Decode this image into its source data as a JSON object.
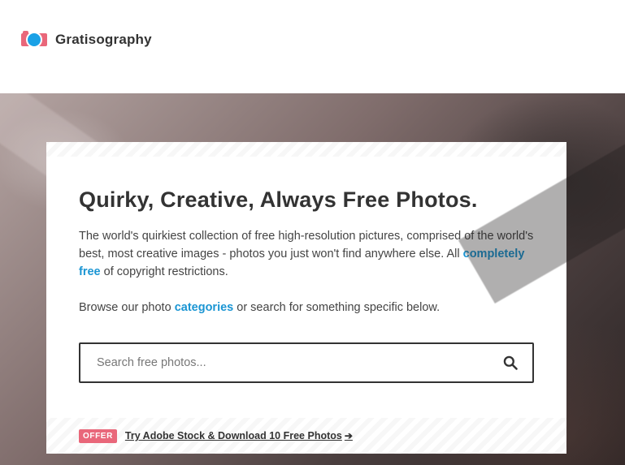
{
  "header": {
    "brand_name": "Gratisography"
  },
  "hero": {
    "title": "Quirky, Creative, Always Free Photos.",
    "intro": {
      "before_link": "The world's quirkiest collection of free high-resolution pictures, comprised of the world's best, most creative images - photos you just won't find anywhere else. All ",
      "link_text": "completely free",
      "after_link": " of copyright restrictions."
    },
    "browse": {
      "before_link": "Browse our photo ",
      "link_text": "categories",
      "after_link": " or search for something specific below."
    },
    "search": {
      "value": "",
      "placeholder": "Search free photos..."
    },
    "offer": {
      "badge": "OFFER",
      "text": "Try Adobe Stock & Download 10 Free Photos",
      "arrow": "➔"
    }
  },
  "colors": {
    "accent_blue": "#1a95d3",
    "badge_pink": "#e9677a",
    "logo_blue": "#1aa1e6",
    "text_dark": "#333333"
  },
  "icons": {
    "logo": "camera-logo-icon",
    "search": "search-icon",
    "offer_arrow": "arrow-right-icon"
  }
}
